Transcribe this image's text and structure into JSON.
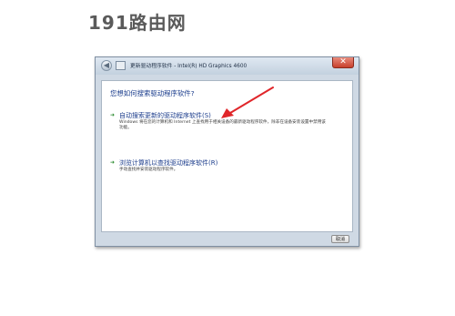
{
  "watermark": "191路由网",
  "window": {
    "title": "更新驱动程序软件 - Intel(R) HD Graphics 4600",
    "close_glyph": "✕",
    "back_glyph": "◀"
  },
  "prompt": {
    "question": "您想如何搜索驱动程序软件?",
    "options": [
      {
        "title": "自动搜索更新的驱动程序软件(S)",
        "description": "Windows 将在您的计算机和 Internet 上查找用于相关设备的最新驱动程序软件，除非在设备安装设置中禁用该功能。"
      },
      {
        "title": "浏览计算机以查找驱动程序软件(R)",
        "description": "手动查找并安装驱动程序软件。"
      }
    ],
    "arrow_glyph": "➜"
  },
  "footer": {
    "cancel_label": "取消"
  },
  "colors": {
    "annotation_arrow": "#e0262a",
    "link": "#1c3d8c"
  }
}
